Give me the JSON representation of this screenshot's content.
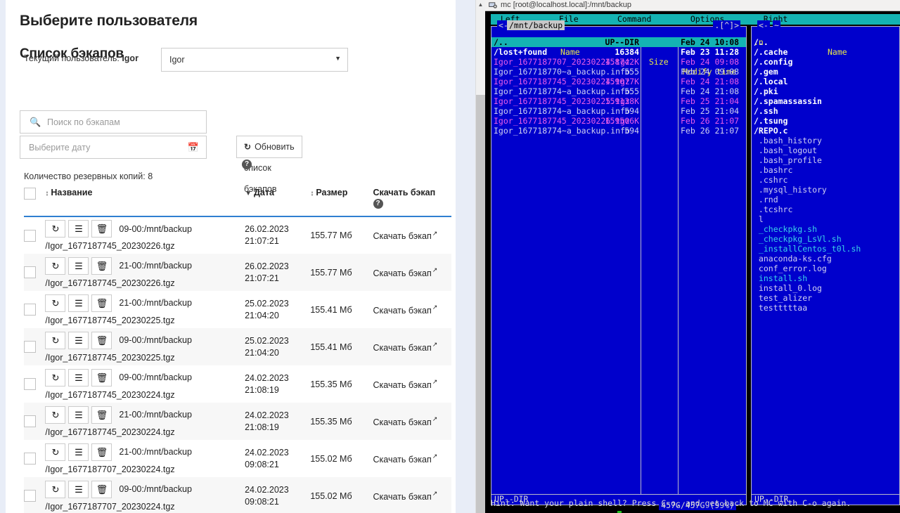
{
  "webapp": {
    "page_title": "Выберите пользователя",
    "current_user_label": "Текущий пользователь:",
    "current_user_value": "Igor",
    "user_select_value": "Igor",
    "section_title": "Список бэкапов",
    "search_placeholder": "Поиск по бэкапам",
    "date_placeholder": "Выберите дату",
    "refresh_label": "Обновить список бэкапов",
    "count_label": "Количество резервных копий: 8",
    "columns": {
      "name": "Название",
      "date": "Дата",
      "size": "Размер",
      "download": "Скачать бэкап"
    },
    "download_link_label": "Скачать бэкап",
    "rows": [
      {
        "name_head": "09-00:/mnt/backup",
        "name_path": "/Igor_1677187745_20230226.tgz",
        "date": "26.02.2023",
        "time": "21:07:21",
        "size": "155.77 Мб"
      },
      {
        "name_head": "21-00:/mnt/backup",
        "name_path": "/Igor_1677187745_20230226.tgz",
        "date": "26.02.2023",
        "time": "21:07:21",
        "size": "155.77 Мб"
      },
      {
        "name_head": "21-00:/mnt/backup",
        "name_path": "/Igor_1677187745_20230225.tgz",
        "date": "25.02.2023",
        "time": "21:04:20",
        "size": "155.41 Мб"
      },
      {
        "name_head": "09-00:/mnt/backup",
        "name_path": "/Igor_1677187745_20230225.tgz",
        "date": "25.02.2023",
        "time": "21:04:20",
        "size": "155.41 Мб"
      },
      {
        "name_head": "09-00:/mnt/backup",
        "name_path": "/Igor_1677187745_20230224.tgz",
        "date": "24.02.2023",
        "time": "21:08:19",
        "size": "155.35 Мб"
      },
      {
        "name_head": "21-00:/mnt/backup",
        "name_path": "/Igor_1677187745_20230224.tgz",
        "date": "24.02.2023",
        "time": "21:08:19",
        "size": "155.35 Мб"
      },
      {
        "name_head": "21-00:/mnt/backup",
        "name_path": "/Igor_1677187707_20230224.tgz",
        "date": "24.02.2023",
        "time": "09:08:21",
        "size": "155.02 Мб"
      },
      {
        "name_head": "09-00:/mnt/backup",
        "name_path": "/Igor_1677187707_20230224.tgz",
        "date": "24.02.2023",
        "time": "09:08:21",
        "size": "155.02 Мб"
      }
    ],
    "row_buttons": {
      "restore": "restore-icon",
      "details": "list-icon",
      "delete": "trash-icon"
    },
    "accent_color": "#2f7fd1"
  },
  "mc": {
    "window_title": "mc [root@localhost.local]:/mnt/backup",
    "menu": "  Left        File        Command        Options        Right",
    "menu_items": [
      "Left",
      "File",
      "Command",
      "Options",
      "Right"
    ],
    "left_panel": {
      "path": "/mnt/backup",
      "corner_left": "<-",
      "corner_right": ".[^]>",
      "header": {
        "dotn": ".n",
        "name": "Name",
        "size": "Size",
        "time": "Modify time"
      },
      "entries": [
        {
          "name": "/..",
          "size": "UP--DIR",
          "time": "Feb 24 10:08",
          "kind": "dir",
          "selected": true
        },
        {
          "name": "/lost+found",
          "size": "16384",
          "time": "Feb 23 11:28",
          "kind": "dir",
          "selected": false
        },
        {
          "name": "Igor_1677187707_20230224.tgz",
          "size": "158742K",
          "time": "Feb 24 09:08",
          "kind": "arch",
          "selected": false
        },
        {
          "name": "Igor_167718770~a_backup.info",
          "size": "555",
          "time": "Feb 24 09:08",
          "kind": "file",
          "selected": false
        },
        {
          "name": "Igor_1677187745_20230224.tgz",
          "size": "159077K",
          "time": "Feb 24 21:08",
          "kind": "arch",
          "selected": false
        },
        {
          "name": "Igor_167718774~a_backup.info",
          "size": "555",
          "time": "Feb 24 21:08",
          "kind": "file",
          "selected": false
        },
        {
          "name": "Igor_1677187745_20230225.tgz",
          "size": "159138K",
          "time": "Feb 25 21:04",
          "kind": "arch",
          "selected": false
        },
        {
          "name": "Igor_167718774~a_backup.info",
          "size": "594",
          "time": "Feb 25 21:04",
          "kind": "file",
          "selected": false
        },
        {
          "name": "Igor_1677187745_20230226.tgz",
          "size": "159506K",
          "time": "Feb 26 21:07",
          "kind": "arch",
          "selected": false
        },
        {
          "name": "Igor_167718774~a_backup.info",
          "size": "594",
          "time": "Feb 26 21:07",
          "kind": "file",
          "selected": false
        }
      ],
      "mini_status": "UP--DIR",
      "free_space": "457G/457G (99%)"
    },
    "right_panel": {
      "path": "~",
      "corner_left": "<-",
      "header": {
        "dotn": ".n",
        "name": "Name"
      },
      "entries": [
        {
          "name": "/..",
          "kind": "dir"
        },
        {
          "name": "/.cache",
          "kind": "dir"
        },
        {
          "name": "/.config",
          "kind": "dir"
        },
        {
          "name": "/.gem",
          "kind": "dir"
        },
        {
          "name": "/.local",
          "kind": "dir"
        },
        {
          "name": "/.pki",
          "kind": "dir"
        },
        {
          "name": "/.spamassassin",
          "kind": "dir"
        },
        {
          "name": "/.ssh",
          "kind": "dir"
        },
        {
          "name": "/.tsung",
          "kind": "dir"
        },
        {
          "name": "/REPO.c",
          "kind": "dir"
        },
        {
          "name": " .bash_history",
          "kind": "file"
        },
        {
          "name": " .bash_logout",
          "kind": "file"
        },
        {
          "name": " .bash_profile",
          "kind": "file"
        },
        {
          "name": " .bashrc",
          "kind": "file"
        },
        {
          "name": " .cshrc",
          "kind": "file"
        },
        {
          "name": " .mysql_history",
          "kind": "file"
        },
        {
          "name": " .rnd",
          "kind": "file"
        },
        {
          "name": " .tcshrc",
          "kind": "file"
        },
        {
          "name": " l",
          "kind": "file"
        },
        {
          "name": " _checkpkg.sh",
          "kind": "exec"
        },
        {
          "name": " _checkpkg_LsVl.sh",
          "kind": "exec"
        },
        {
          "name": " _installCentos_t0l.sh",
          "kind": "exec"
        },
        {
          "name": " anaconda-ks.cfg",
          "kind": "file"
        },
        {
          "name": " conf_error.log",
          "kind": "file"
        },
        {
          "name": " install.sh",
          "kind": "exec"
        },
        {
          "name": " install_0.log",
          "kind": "file"
        },
        {
          "name": " test_alizer",
          "kind": "file"
        },
        {
          "name": " testttttaa",
          "kind": "file"
        }
      ],
      "mini_status": "UP--DIR"
    },
    "hint": "Hint: Want your plain shell? Press C-o, and get back to MC with C-o again.",
    "colors": {
      "panel_bg": "#0000cc",
      "menu_bg": "#14b3b3",
      "archive": "#e85ce8",
      "executable": "#3ad2e8",
      "terminal_bg": "#000000"
    }
  }
}
